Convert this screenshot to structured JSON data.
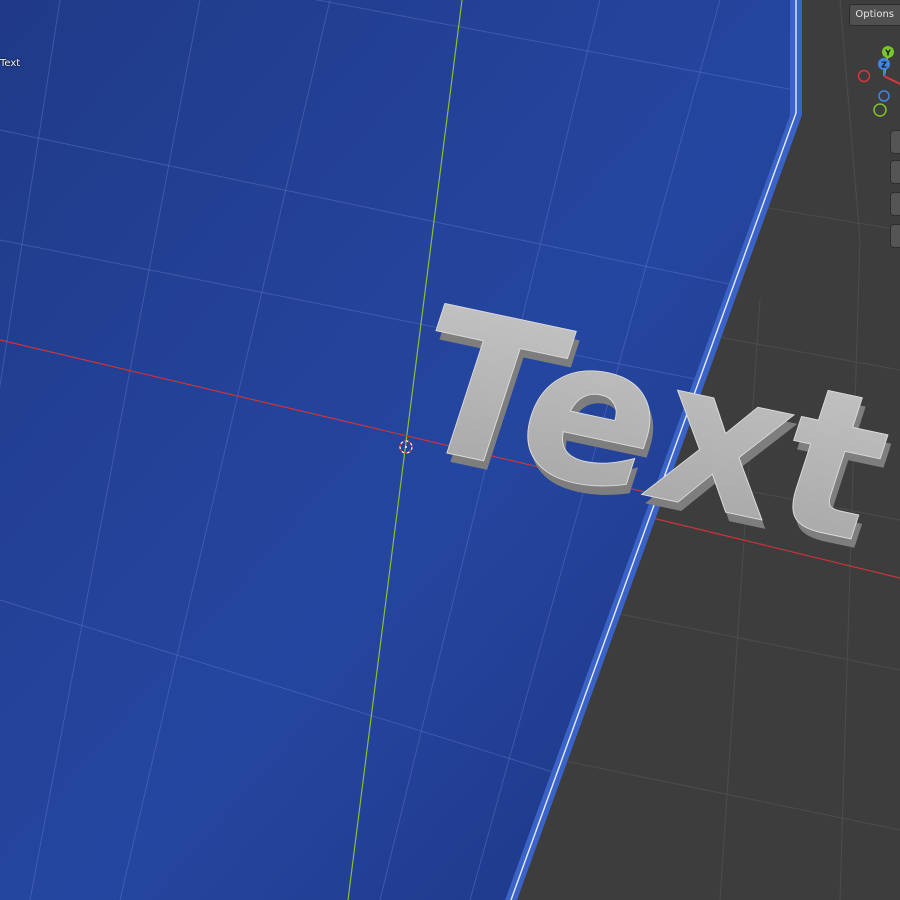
{
  "viewport": {
    "object_label": "Text",
    "options_label": "Options",
    "object_text": "Text"
  },
  "gizmo": {
    "y_label": "Y",
    "z_label": "Z",
    "x_color": "#d6373c",
    "y_color": "#7bc62a",
    "z_color": "#3f87e4"
  },
  "colors": {
    "plane_blue": "#213f8f",
    "plane_edge": "#3a63c9",
    "background": "#3d3d3d",
    "x_axis": "#c9353d",
    "y_axis": "#8cbf2d",
    "text_object": "#b9b9b9"
  },
  "tools": [
    "zoom-icon",
    "hand-icon",
    "camera-icon",
    "grid-icon"
  ]
}
